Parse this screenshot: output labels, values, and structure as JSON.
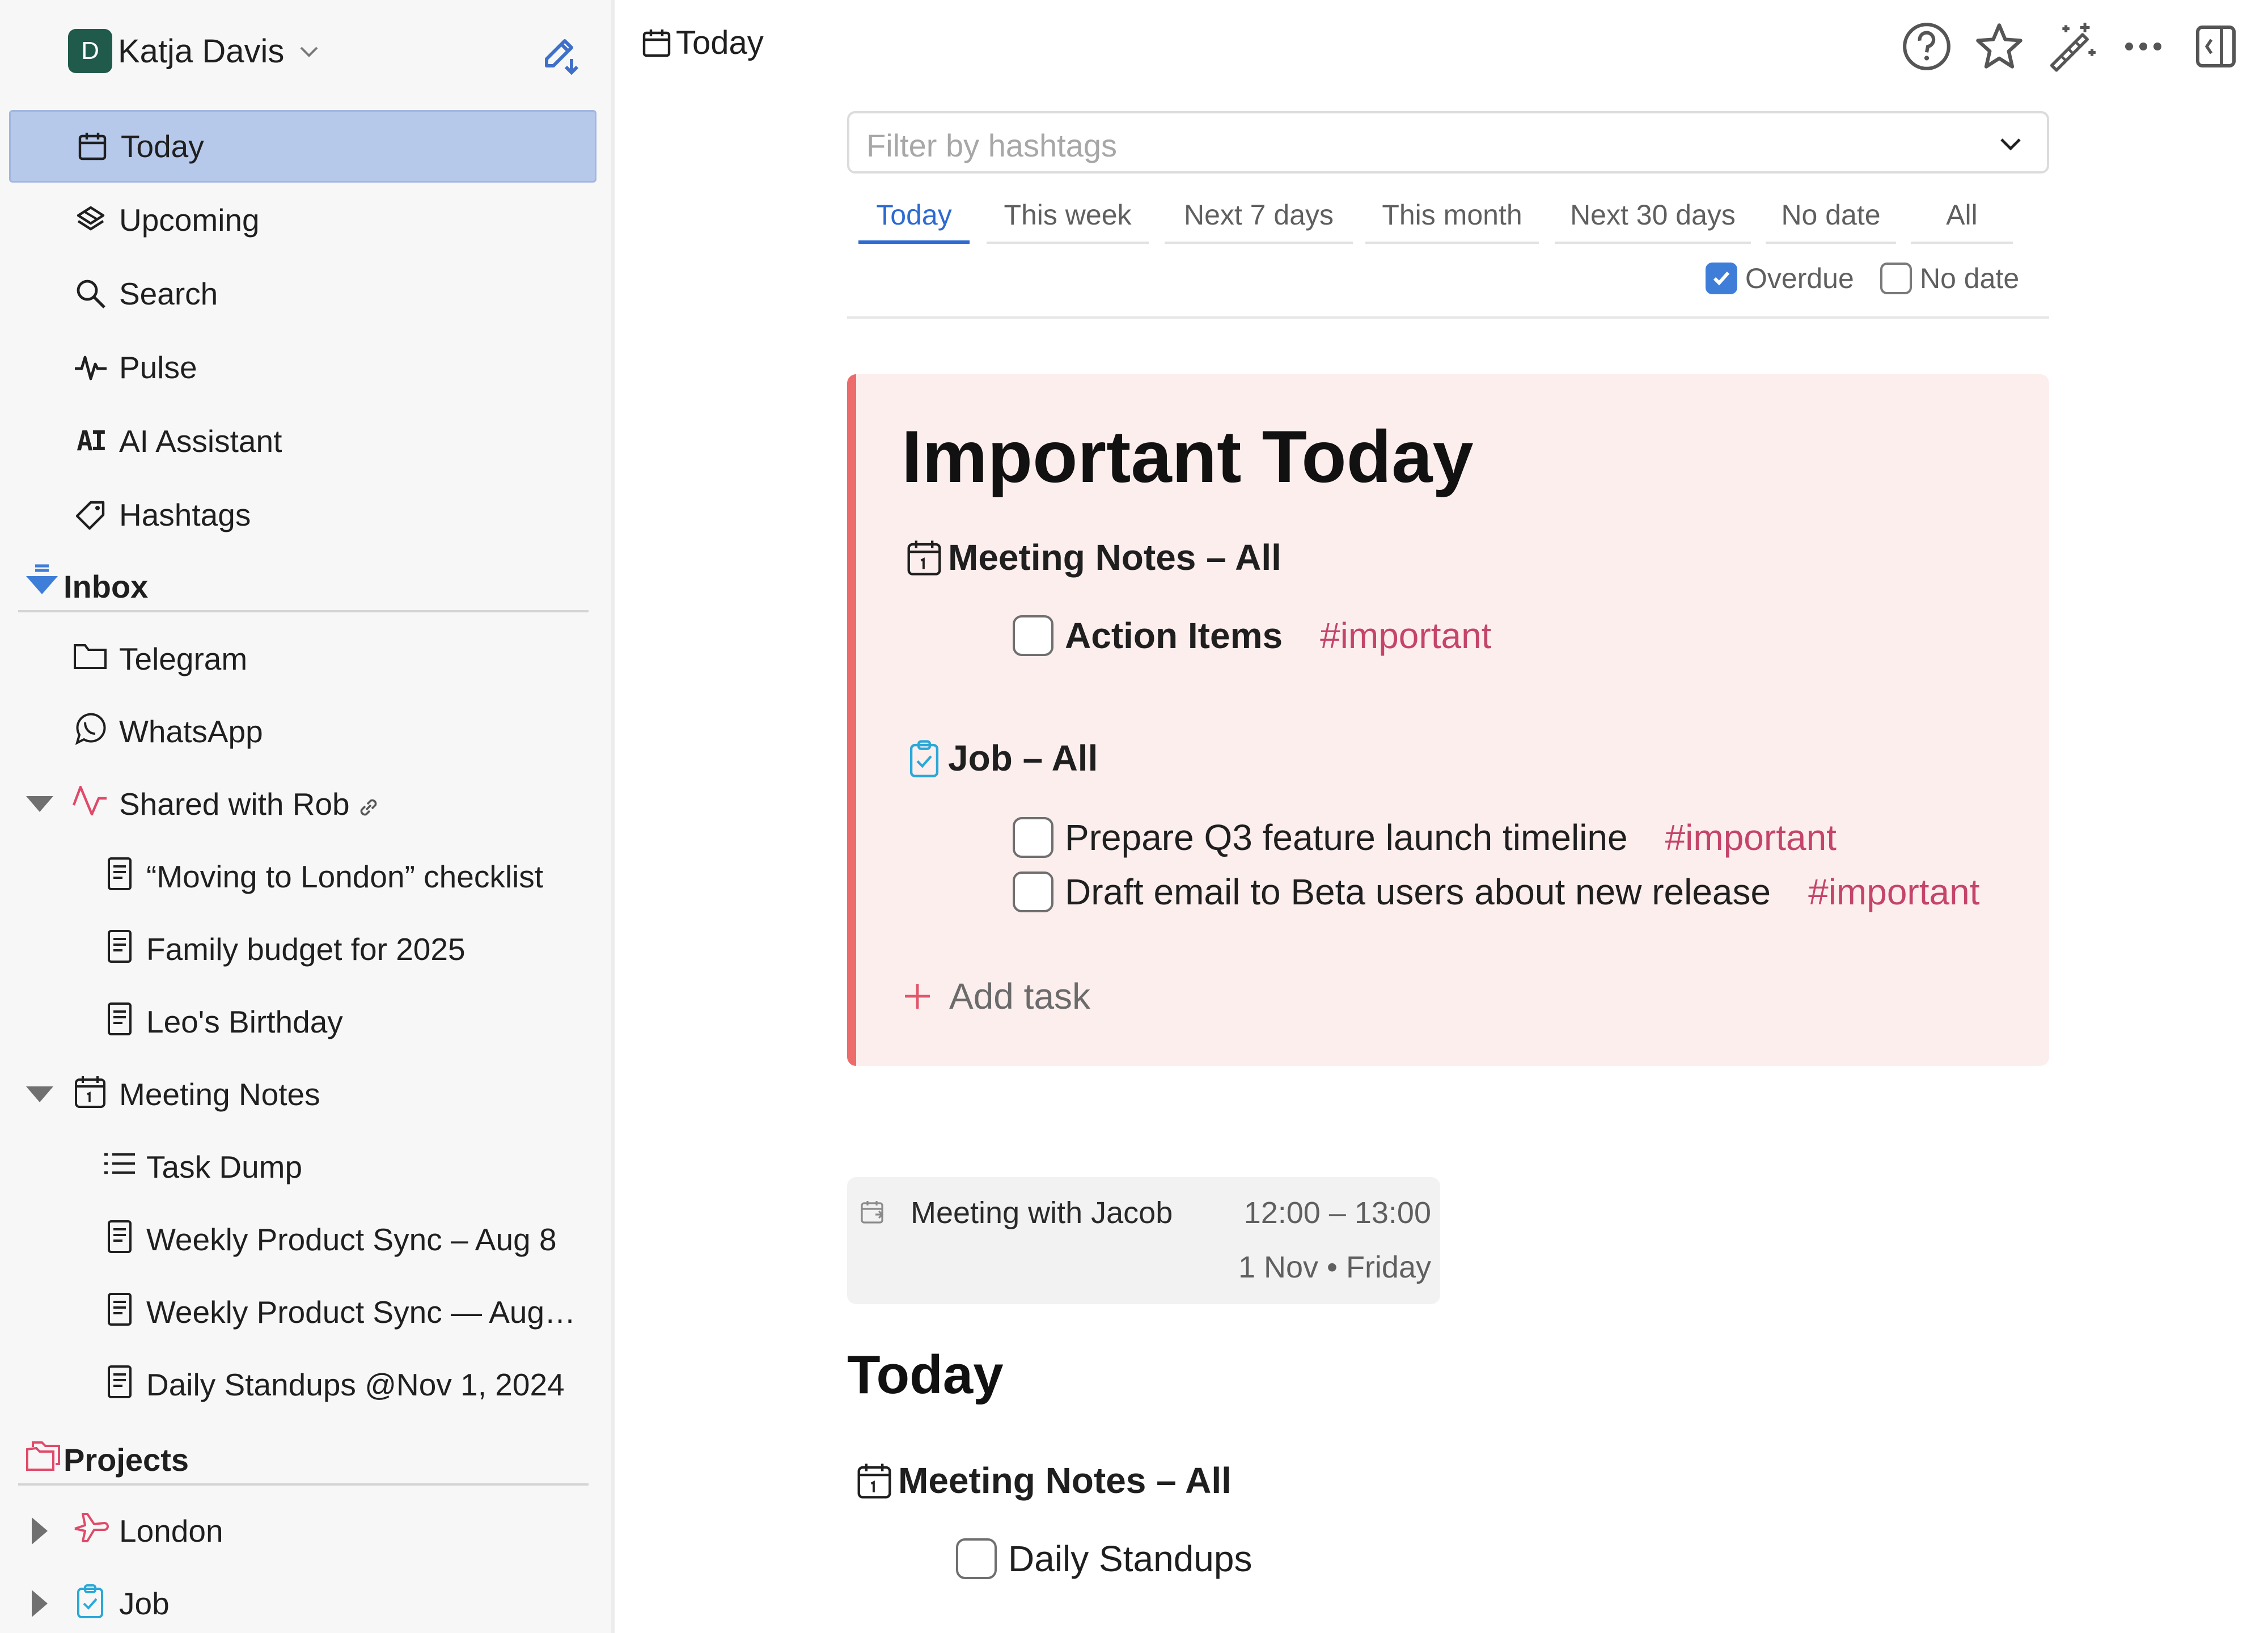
{
  "user": {
    "initial": "D",
    "name": "Katja Davis"
  },
  "nav": [
    {
      "label": "Today",
      "icon": "calendar-icon",
      "active": true
    },
    {
      "label": "Upcoming",
      "icon": "upcoming-icon"
    },
    {
      "label": "Search",
      "icon": "search-icon"
    },
    {
      "label": "Pulse",
      "icon": "pulse-icon"
    },
    {
      "label": "AI Assistant",
      "icon": "ai-icon",
      "glyph": "AI"
    },
    {
      "label": "Hashtags",
      "icon": "hashtag-tag-icon"
    }
  ],
  "inbox": {
    "label": "Inbox",
    "items": [
      {
        "label": "Telegram",
        "icon": "folder-icon"
      },
      {
        "label": "WhatsApp",
        "icon": "whatsapp-icon"
      },
      {
        "label": "Shared with Rob",
        "icon": "shared-pulse-icon"
      },
      {
        "label": "“Moving to London” checklist",
        "icon": "document-icon"
      },
      {
        "label": "Family budget for 2025",
        "icon": "document-icon"
      },
      {
        "label": "Leo's Birthday",
        "icon": "document-icon"
      },
      {
        "label": "Meeting Notes",
        "icon": "calendar-icon"
      },
      {
        "label": "Task Dump",
        "icon": "list-icon"
      },
      {
        "label": "Weekly Product Sync – Aug 8",
        "icon": "document-icon"
      },
      {
        "label": "Weekly Product Sync — Aug…",
        "icon": "document-icon"
      },
      {
        "label": "Daily Standups @Nov 1, 2024",
        "icon": "document-icon"
      }
    ]
  },
  "projects": {
    "label": "Projects",
    "items": [
      {
        "label": "London",
        "icon": "plane-icon"
      },
      {
        "label": "Job",
        "icon": "clipboard-icon"
      }
    ]
  },
  "header": {
    "title": "Today"
  },
  "filter": {
    "placeholder": "Filter by hashtags"
  },
  "tabs": [
    "Today",
    "This week",
    "Next 7 days",
    "This month",
    "Next 30 days",
    "No date",
    "All"
  ],
  "active_tab": "Today",
  "options": [
    {
      "label": "Overdue",
      "checked": true
    },
    {
      "label": "No date",
      "checked": false
    }
  ],
  "important": {
    "title": "Important Today",
    "groups": [
      {
        "title": "Meeting Notes – All",
        "tasks": [
          {
            "text": "Action Items",
            "tag": "#important",
            "bold": true
          }
        ]
      },
      {
        "title": "Job – All",
        "tasks": [
          {
            "text": "Prepare Q3 feature launch timeline",
            "tag": "#important"
          },
          {
            "text": "Draft email to Beta users about new release",
            "tag": "#important"
          }
        ]
      }
    ],
    "add_task": "Add task"
  },
  "event": {
    "title": "Meeting with Jacob",
    "time": "12:00 – 13:00",
    "date": "1 Nov • Friday"
  },
  "today_section": {
    "title": "Today",
    "group": "Meeting Notes – All",
    "tasks": [
      {
        "text": "Daily Standups"
      }
    ]
  },
  "colors": {
    "accent": "#2d6ad1",
    "active_nav_bg": "#b6c9ea",
    "important_bg": "#fdeeee",
    "important_border": "#ee6b6b",
    "hashtag": "#c44569",
    "avatar": "#1f5a4a"
  }
}
